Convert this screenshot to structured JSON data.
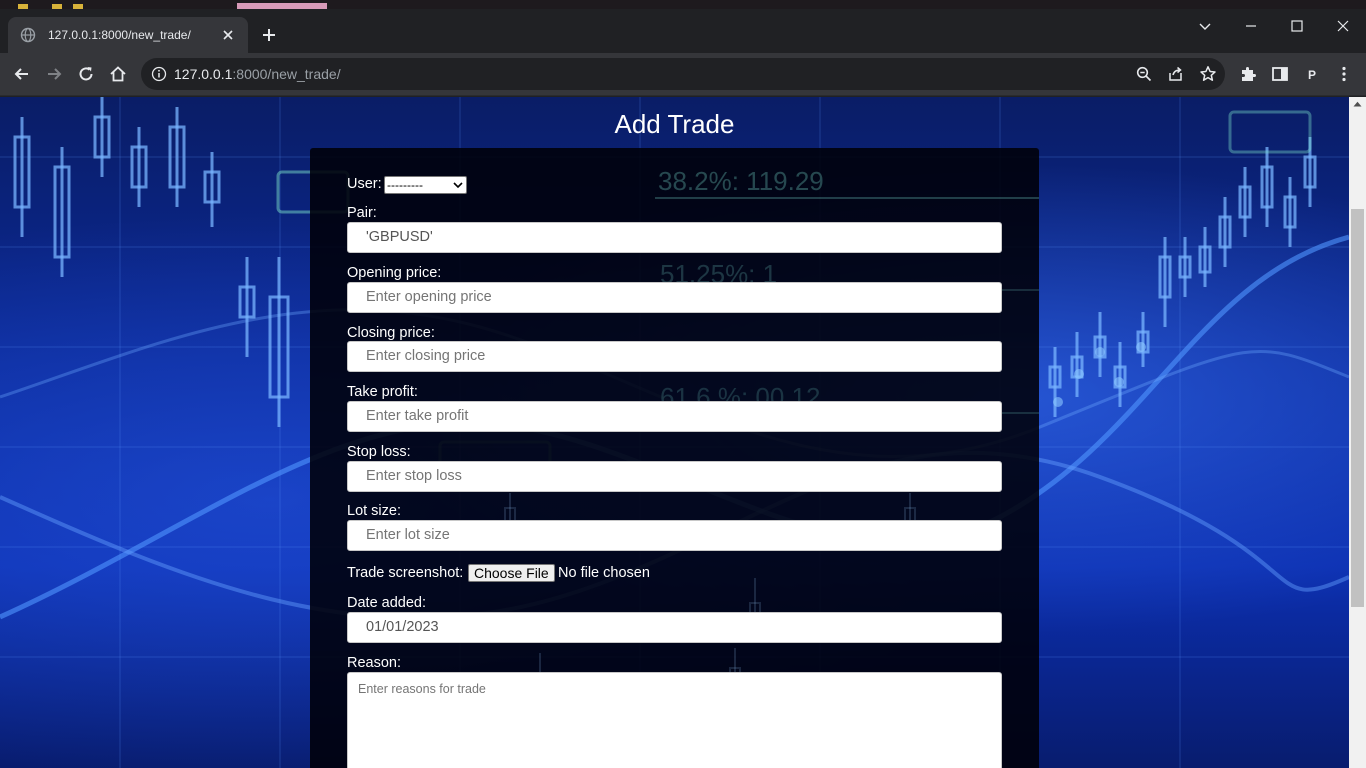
{
  "browser": {
    "tab_title": "127.0.0.1:8000/new_trade/",
    "url_host": "127.0.0.1",
    "url_rest": ":8000/new_trade/",
    "profile_initial": "P",
    "icons": [
      "globe-icon",
      "close-icon",
      "plus-icon",
      "chevron-down-icon",
      "minimize-icon",
      "maximize-icon",
      "window-close-icon",
      "back-icon",
      "forward-icon",
      "reload-icon",
      "home-icon",
      "info-icon",
      "zoom-icon",
      "share-icon",
      "star-icon",
      "extensions-icon",
      "side-panel-icon",
      "menu-icon"
    ]
  },
  "page": {
    "title": "Add Trade"
  },
  "form": {
    "user_label": "User:",
    "user_selected": "---------",
    "pair_label": "Pair:",
    "pair_value": "'GBPUSD'",
    "opening_label": "Opening price:",
    "opening_placeholder": "Enter opening price",
    "closing_label": "Closing price:",
    "closing_placeholder": "Enter closing price",
    "tp_label": "Take profit:",
    "tp_placeholder": "Enter take profit",
    "sl_label": "Stop loss:",
    "sl_placeholder": "Enter stop loss",
    "lot_label": "Lot size:",
    "lot_placeholder": "Enter lot size",
    "screenshot_label": "Trade screenshot:",
    "choose_file": "Choose File",
    "no_file": "No file chosen",
    "date_label": "Date added:",
    "date_value": "01/01/2023",
    "reason_label": "Reason:",
    "reason_placeholder": "Enter reasons for trade"
  },
  "background_text": {
    "fib1": "38.2%: 119.29",
    "fib2": "51.25%: 1",
    "fib3": "61.6 %: 00.12"
  },
  "colors": {
    "accent_bg": "#0b2a9a",
    "card": "#000008"
  }
}
